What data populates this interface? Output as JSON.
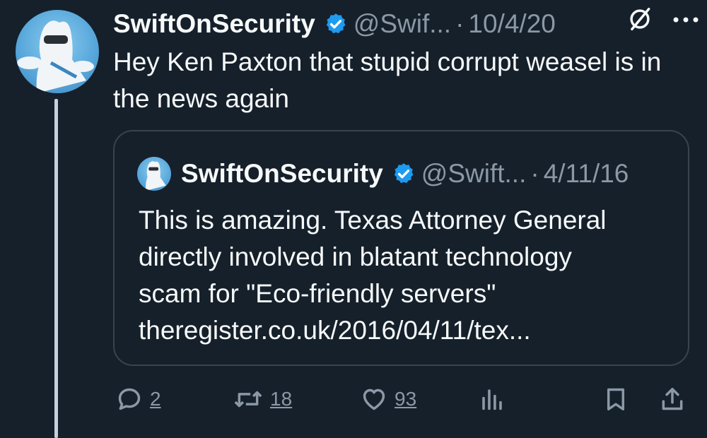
{
  "author": {
    "name": "SwiftOnSecurity",
    "handle": "@Swif...",
    "date": "10/4/20",
    "verified_icon": "verified-badge-icon",
    "avatar_desc": "avatar"
  },
  "tweet": {
    "text": "Hey Ken Paxton that stupid corrupt weasel is in the news again"
  },
  "separator": "·",
  "quoted": {
    "name": "SwiftOnSecurity",
    "handle": "@Swift...",
    "date": "4/11/16",
    "text_lines": [
      "This is amazing. Texas Attorney General",
      "directly involved in blatant technology",
      "scam for \"Eco-friendly servers\"",
      "theregister.co.uk/2016/04/11/tex..."
    ]
  },
  "actions": {
    "replies": "2",
    "retweets": "18",
    "likes": "93"
  },
  "colors": {
    "background": "#15202b",
    "text": "#f7f9f9",
    "muted": "#8b98a5",
    "verified": "#1d9bf0",
    "border": "#38444d"
  }
}
